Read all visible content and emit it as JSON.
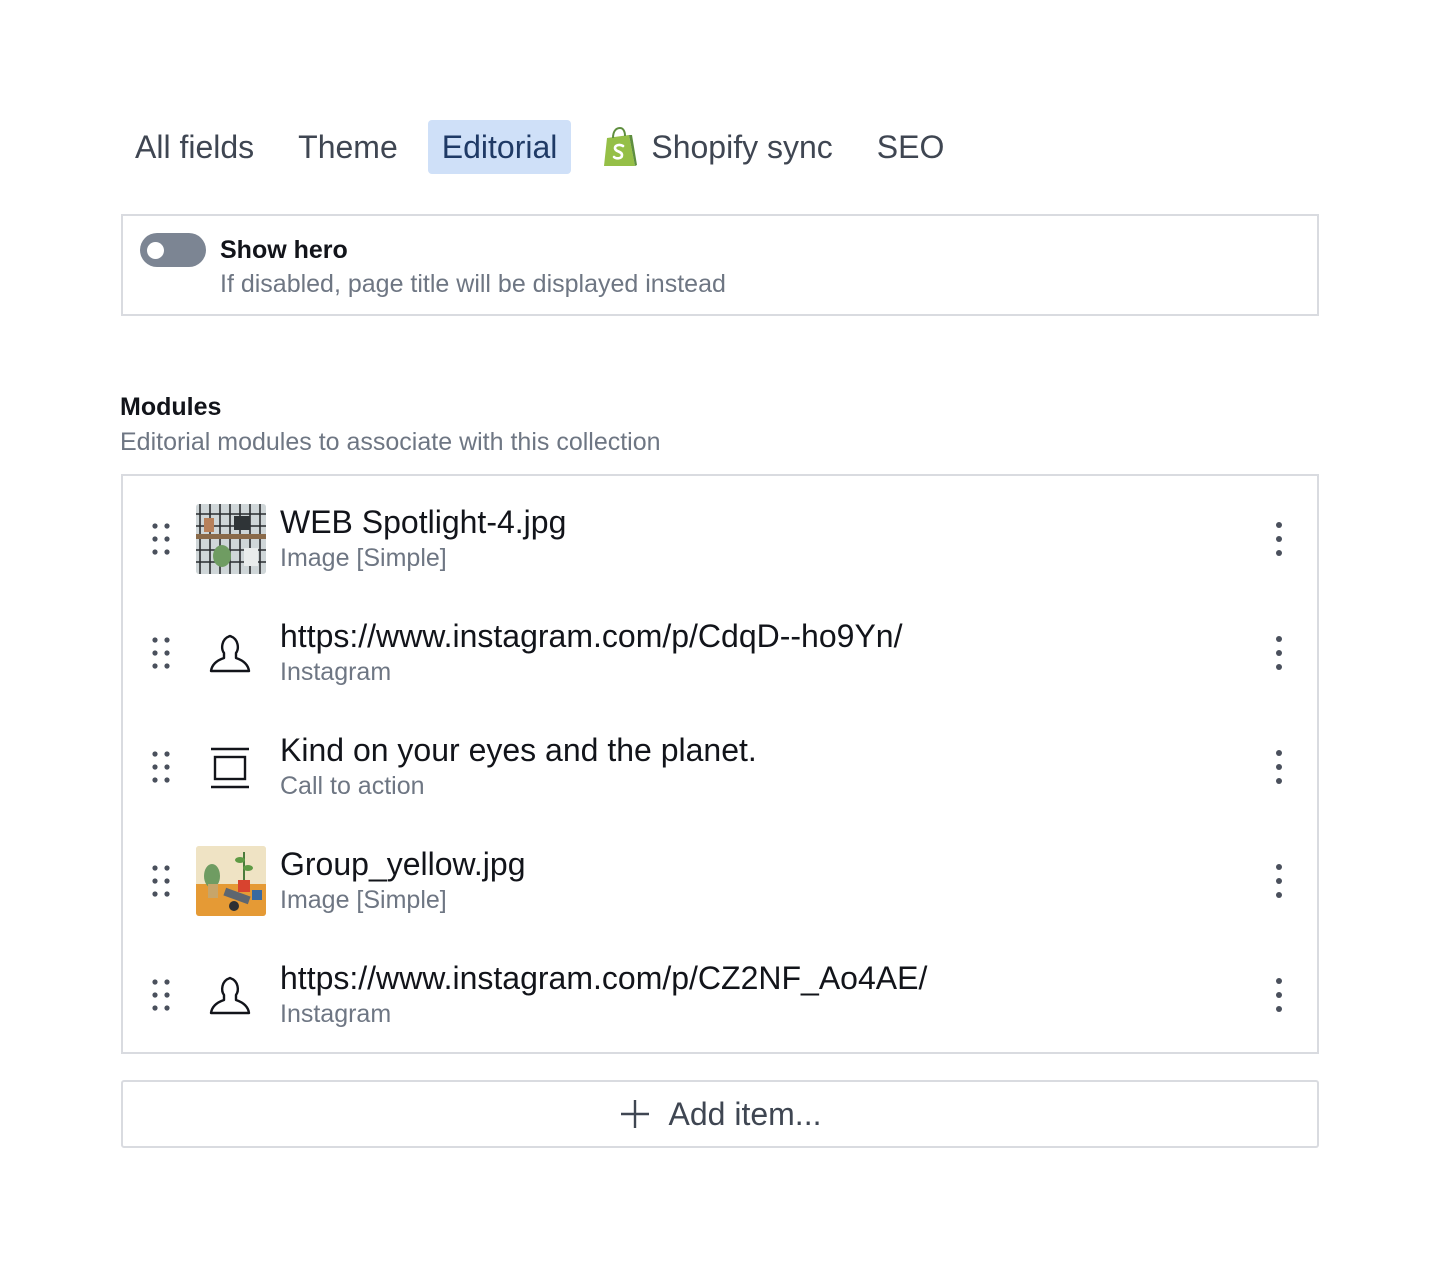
{
  "tabs": [
    {
      "label": "All fields",
      "active": false
    },
    {
      "label": "Theme",
      "active": false
    },
    {
      "label": "Editorial",
      "active": true
    },
    {
      "label": "Shopify sync",
      "active": false,
      "icon": "shopify-bag-icon"
    },
    {
      "label": "SEO",
      "active": false
    }
  ],
  "hero": {
    "title": "Show hero",
    "description": "If disabled, page title will be displayed instead",
    "enabled": false
  },
  "modules": {
    "title": "Modules",
    "description": "Editorial modules to associate with this collection",
    "items": [
      {
        "title": "WEB Spotlight-4.jpg",
        "subtitle": "Image [Simple]",
        "icon": "image-thumbnail-shelf"
      },
      {
        "title": "https://www.instagram.com/p/CdqD--ho9Yn/",
        "subtitle": "Instagram",
        "icon": "user-icon"
      },
      {
        "title": "Kind on your eyes and the planet.",
        "subtitle": "Call to action",
        "icon": "cta-icon"
      },
      {
        "title": "Group_yellow.jpg",
        "subtitle": "Image [Simple]",
        "icon": "image-thumbnail-yellow"
      },
      {
        "title": "https://www.instagram.com/p/CZ2NF_Ao4AE/",
        "subtitle": "Instagram",
        "icon": "user-icon"
      }
    ]
  },
  "add_item": {
    "label": "Add item..."
  },
  "colors": {
    "active_tab_bg": "#cfe0f8",
    "toggle_off": "#7c8593",
    "border": "#d9dbe0",
    "muted_text": "#6e7683",
    "shopify_green": "#95bf47"
  }
}
